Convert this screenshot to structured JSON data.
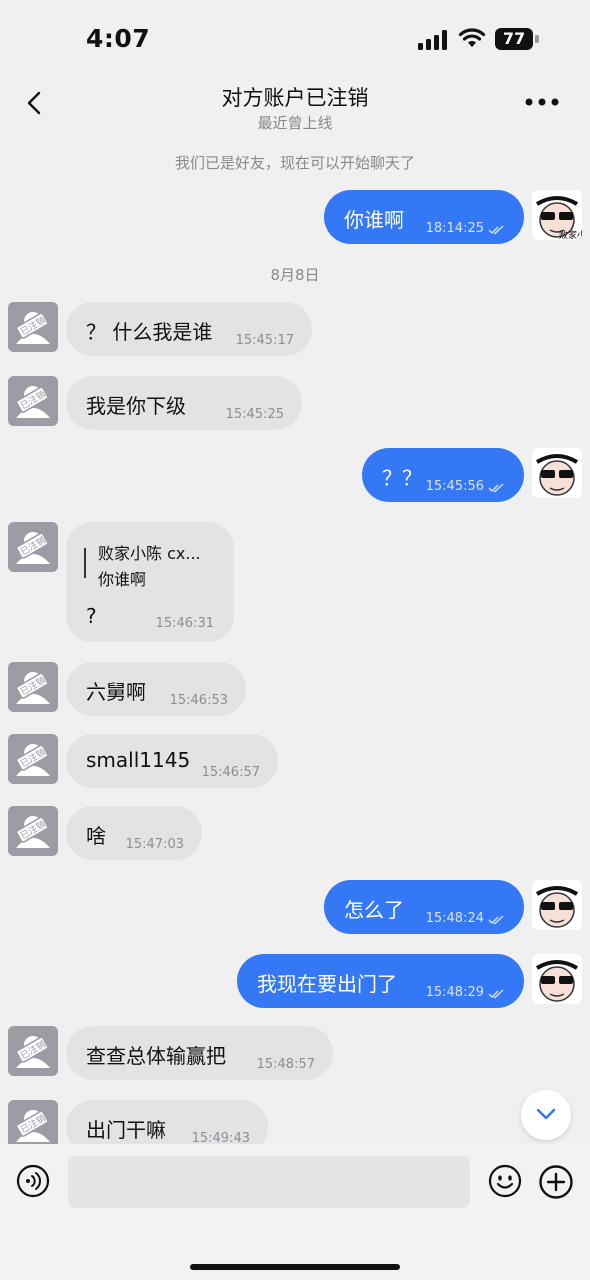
{
  "status_bar": {
    "time": "4:07",
    "battery": "77"
  },
  "nav": {
    "title": "对方账户已注销",
    "subtitle": "最近曾上线"
  },
  "chat": {
    "system_notice": "我们已是好友，现在可以开始聊天了",
    "date_divider": "8月8日",
    "deleted_avatar_label": "已注销",
    "my_avatar_label": "败家小陈",
    "messages": [
      {
        "side": "out",
        "text": "你谁啊",
        "time": "18:14:25"
      },
      {
        "side": "in",
        "text": "？ 什么我是谁",
        "time": "15:45:17"
      },
      {
        "side": "in",
        "text": "我是你下级",
        "time": "15:45:25"
      },
      {
        "side": "out",
        "text": "？？",
        "time": "15:45:56"
      },
      {
        "side": "in",
        "quote_author": "败家小陈 cx...",
        "quote_text": "你谁啊",
        "text": "?",
        "time": "15:46:31"
      },
      {
        "side": "in",
        "text": "六舅啊",
        "time": "15:46:53"
      },
      {
        "side": "in",
        "text": "small1145",
        "time": "15:46:57"
      },
      {
        "side": "in",
        "text": "啥",
        "time": "15:47:03"
      },
      {
        "side": "out",
        "text": "怎么了",
        "time": "15:48:24"
      },
      {
        "side": "out",
        "text": "我现在要出门了",
        "time": "15:48:29"
      },
      {
        "side": "in",
        "text": "查查总体输赢把",
        "time": "15:48:57"
      },
      {
        "side": "in",
        "text": "出门干嘛",
        "time": "15:49:43"
      }
    ]
  },
  "input": {
    "placeholder": ""
  },
  "icons": {
    "back": "chevron-left-icon",
    "more": "more-dots-icon",
    "voice": "voice-icon",
    "emoji": "emoji-icon",
    "plus": "plus-icon",
    "scroll": "chevron-down-icon"
  },
  "colors": {
    "out_bubble": "#3478f6",
    "in_bubble": "#e3e3e5",
    "background": "#f0f0f0"
  }
}
